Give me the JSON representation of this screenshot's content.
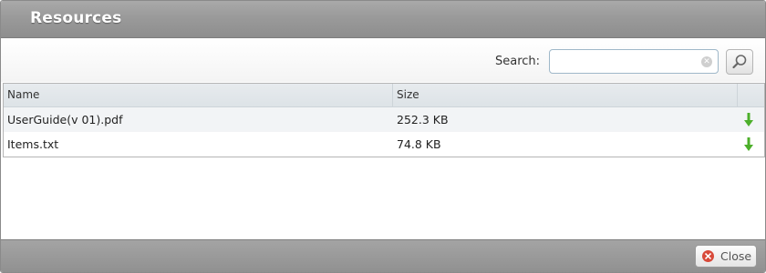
{
  "dialog": {
    "title": "Resources"
  },
  "search": {
    "label": "Search:",
    "value": "",
    "placeholder": ""
  },
  "grid": {
    "columns": [
      "Name",
      "Size"
    ],
    "rows": [
      {
        "name": "UserGuide(v 01).pdf",
        "size": "252.3 KB",
        "action_icon": "download-arrow-icon"
      },
      {
        "name": "Items.txt",
        "size": "74.8 KB",
        "action_icon": "download-arrow-icon"
      }
    ]
  },
  "footer": {
    "close_label": "Close"
  },
  "colors": {
    "download": "#4caf2a",
    "close_icon": "#d84a3a"
  }
}
